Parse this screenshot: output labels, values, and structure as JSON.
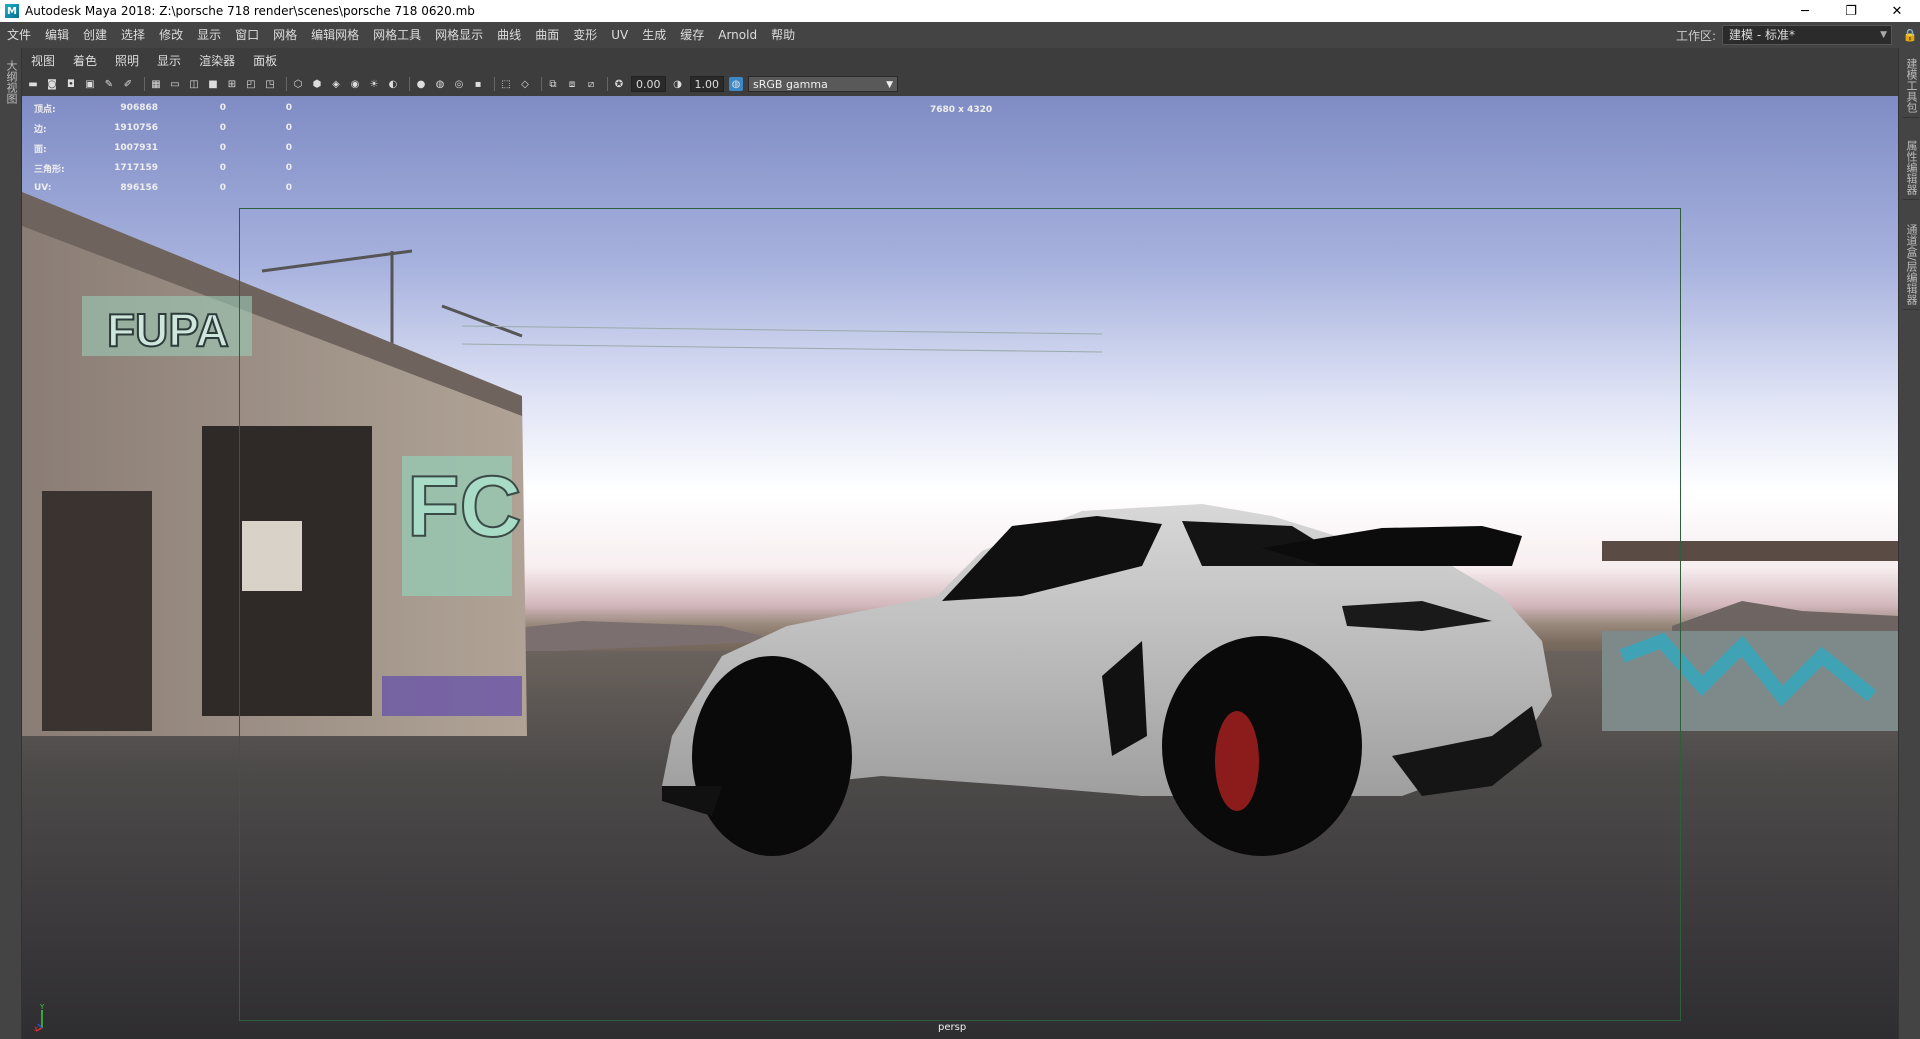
{
  "window": {
    "title": "Autodesk Maya 2018: Z:\\porsche 718 render\\scenes\\porsche 718 0620.mb",
    "minimize": "─",
    "restore": "❐",
    "close": "✕"
  },
  "menubar": {
    "items": [
      "文件",
      "编辑",
      "创建",
      "选择",
      "修改",
      "显示",
      "窗口",
      "网格",
      "编辑网格",
      "网格工具",
      "网格显示",
      "曲线",
      "曲面",
      "变形",
      "UV",
      "生成",
      "缓存",
      "Arnold",
      "帮助"
    ],
    "workspace_label": "工作区:",
    "workspace_value": "建模 - 标准*"
  },
  "left_sidebar": {
    "tab": "大纲视图"
  },
  "right_sidebar": {
    "tabs": [
      "建模工具包",
      "属性编辑器",
      "通道盒/层编辑器"
    ]
  },
  "panel": {
    "menu": [
      "视图",
      "着色",
      "照明",
      "显示",
      "渲染器",
      "面板"
    ],
    "toolbar": {
      "exposure": "0.00",
      "gamma": "1.00",
      "color_space": "sRGB gamma"
    }
  },
  "viewport": {
    "resolution": "7680 x 4320",
    "camera": "persp",
    "axis_y": "Y",
    "axis_x": "X",
    "stats": [
      {
        "label": "顶点:",
        "v1": "906868",
        "v2": "0",
        "v3": "0"
      },
      {
        "label": "边:",
        "v1": "1910756",
        "v2": "0",
        "v3": "0"
      },
      {
        "label": "面:",
        "v1": "1007931",
        "v2": "0",
        "v3": "0"
      },
      {
        "label": "三角形:",
        "v1": "1717159",
        "v2": "0",
        "v3": "0"
      },
      {
        "label": "UV:",
        "v1": "896156",
        "v2": "0",
        "v3": "0"
      }
    ],
    "graffiti": [
      "FUPA",
      "FC"
    ]
  }
}
